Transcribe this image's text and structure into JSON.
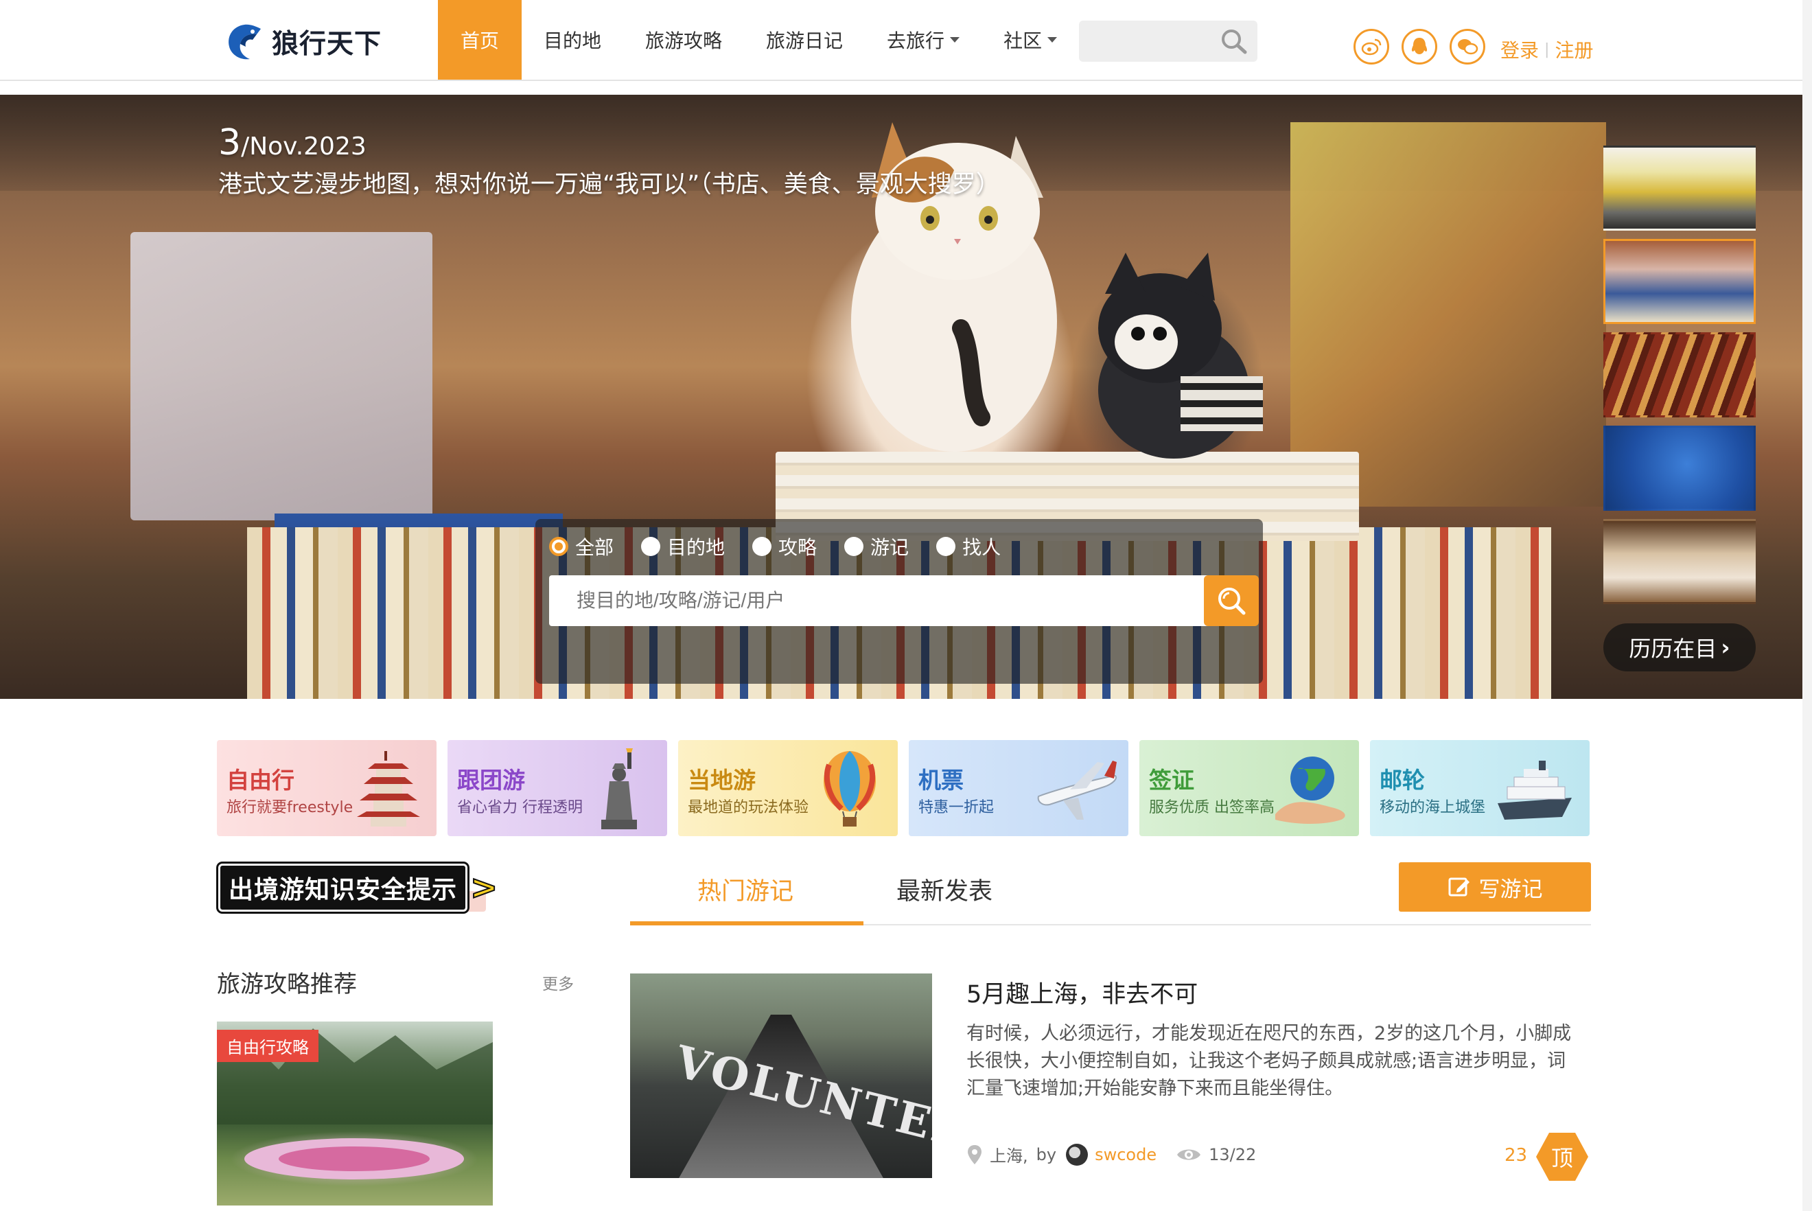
{
  "header": {
    "logo_text": "狼行天下",
    "nav": [
      {
        "label": "首页",
        "active": true,
        "dropdown": false
      },
      {
        "label": "目的地",
        "active": false,
        "dropdown": false
      },
      {
        "label": "旅游攻略",
        "active": false,
        "dropdown": false
      },
      {
        "label": "旅游日记",
        "active": false,
        "dropdown": false
      },
      {
        "label": "去旅行",
        "active": false,
        "dropdown": true
      },
      {
        "label": "社区",
        "active": false,
        "dropdown": true
      }
    ],
    "search": {
      "placeholder": "",
      "icon": "search-icon"
    },
    "social": [
      "weibo-icon",
      "qq-icon",
      "wechat-icon"
    ],
    "login": "登录",
    "register": "注册",
    "separator": "|",
    "accent": "#f39a28"
  },
  "hero": {
    "date_day": "3",
    "date_rest": "/Nov.2023",
    "title": "港式文艺漫步地图，想对你说一万遍“我可以”（书店、美食、景观大搜罗）",
    "more_label": "历历在目",
    "search": {
      "options": [
        {
          "label": "全部",
          "checked": true
        },
        {
          "label": "目的地",
          "checked": false
        },
        {
          "label": "攻略",
          "checked": false
        },
        {
          "label": "游记",
          "checked": false
        },
        {
          "label": "找人",
          "checked": false
        }
      ],
      "placeholder": "搜目的地/攻略/游记/用户"
    }
  },
  "categories": [
    {
      "title": "自由行",
      "subtitle": "旅行就要freestyle",
      "icon": "pagoda-icon"
    },
    {
      "title": "跟团游",
      "subtitle": "省心省力 行程透明",
      "icon": "statue-of-liberty-icon"
    },
    {
      "title": "当地游",
      "subtitle": "最地道的玩法体验",
      "icon": "hot-air-balloon-icon"
    },
    {
      "title": "机票",
      "subtitle": "特惠一折起",
      "icon": "airplane-icon"
    },
    {
      "title": "签证",
      "subtitle": "服务优质 出签率高",
      "icon": "globe-hand-icon"
    },
    {
      "title": "邮轮",
      "subtitle": "移动的海上城堡",
      "icon": "cruise-ship-icon"
    }
  ],
  "notice": {
    "text": "出境游知识安全提示",
    "arrow": ">"
  },
  "guides": {
    "title": "旅游攻略推荐",
    "more": "更多",
    "items": [
      {
        "tag": "自由行攻略"
      }
    ]
  },
  "tabs": [
    {
      "label": "热门游记",
      "active": true
    },
    {
      "label": "最新发表",
      "active": false
    }
  ],
  "write_button": "写游记",
  "posts": [
    {
      "title": "5月趣上海，非去不可",
      "body": "有时候，人必须远行，才能发现近在咫尺的东西，2岁的这几个月，小脚成长很快，大小便控制自如，让我这个老妈子颇具成就感;语言进步明显，词汇量飞速增加;开始能安静下来而且能坐得住。",
      "location": "上海,",
      "by": "by",
      "author": "swcode",
      "views": "13/22",
      "likes": "23",
      "top_label": "顶",
      "image_word": "VOLUNTEER"
    }
  ]
}
